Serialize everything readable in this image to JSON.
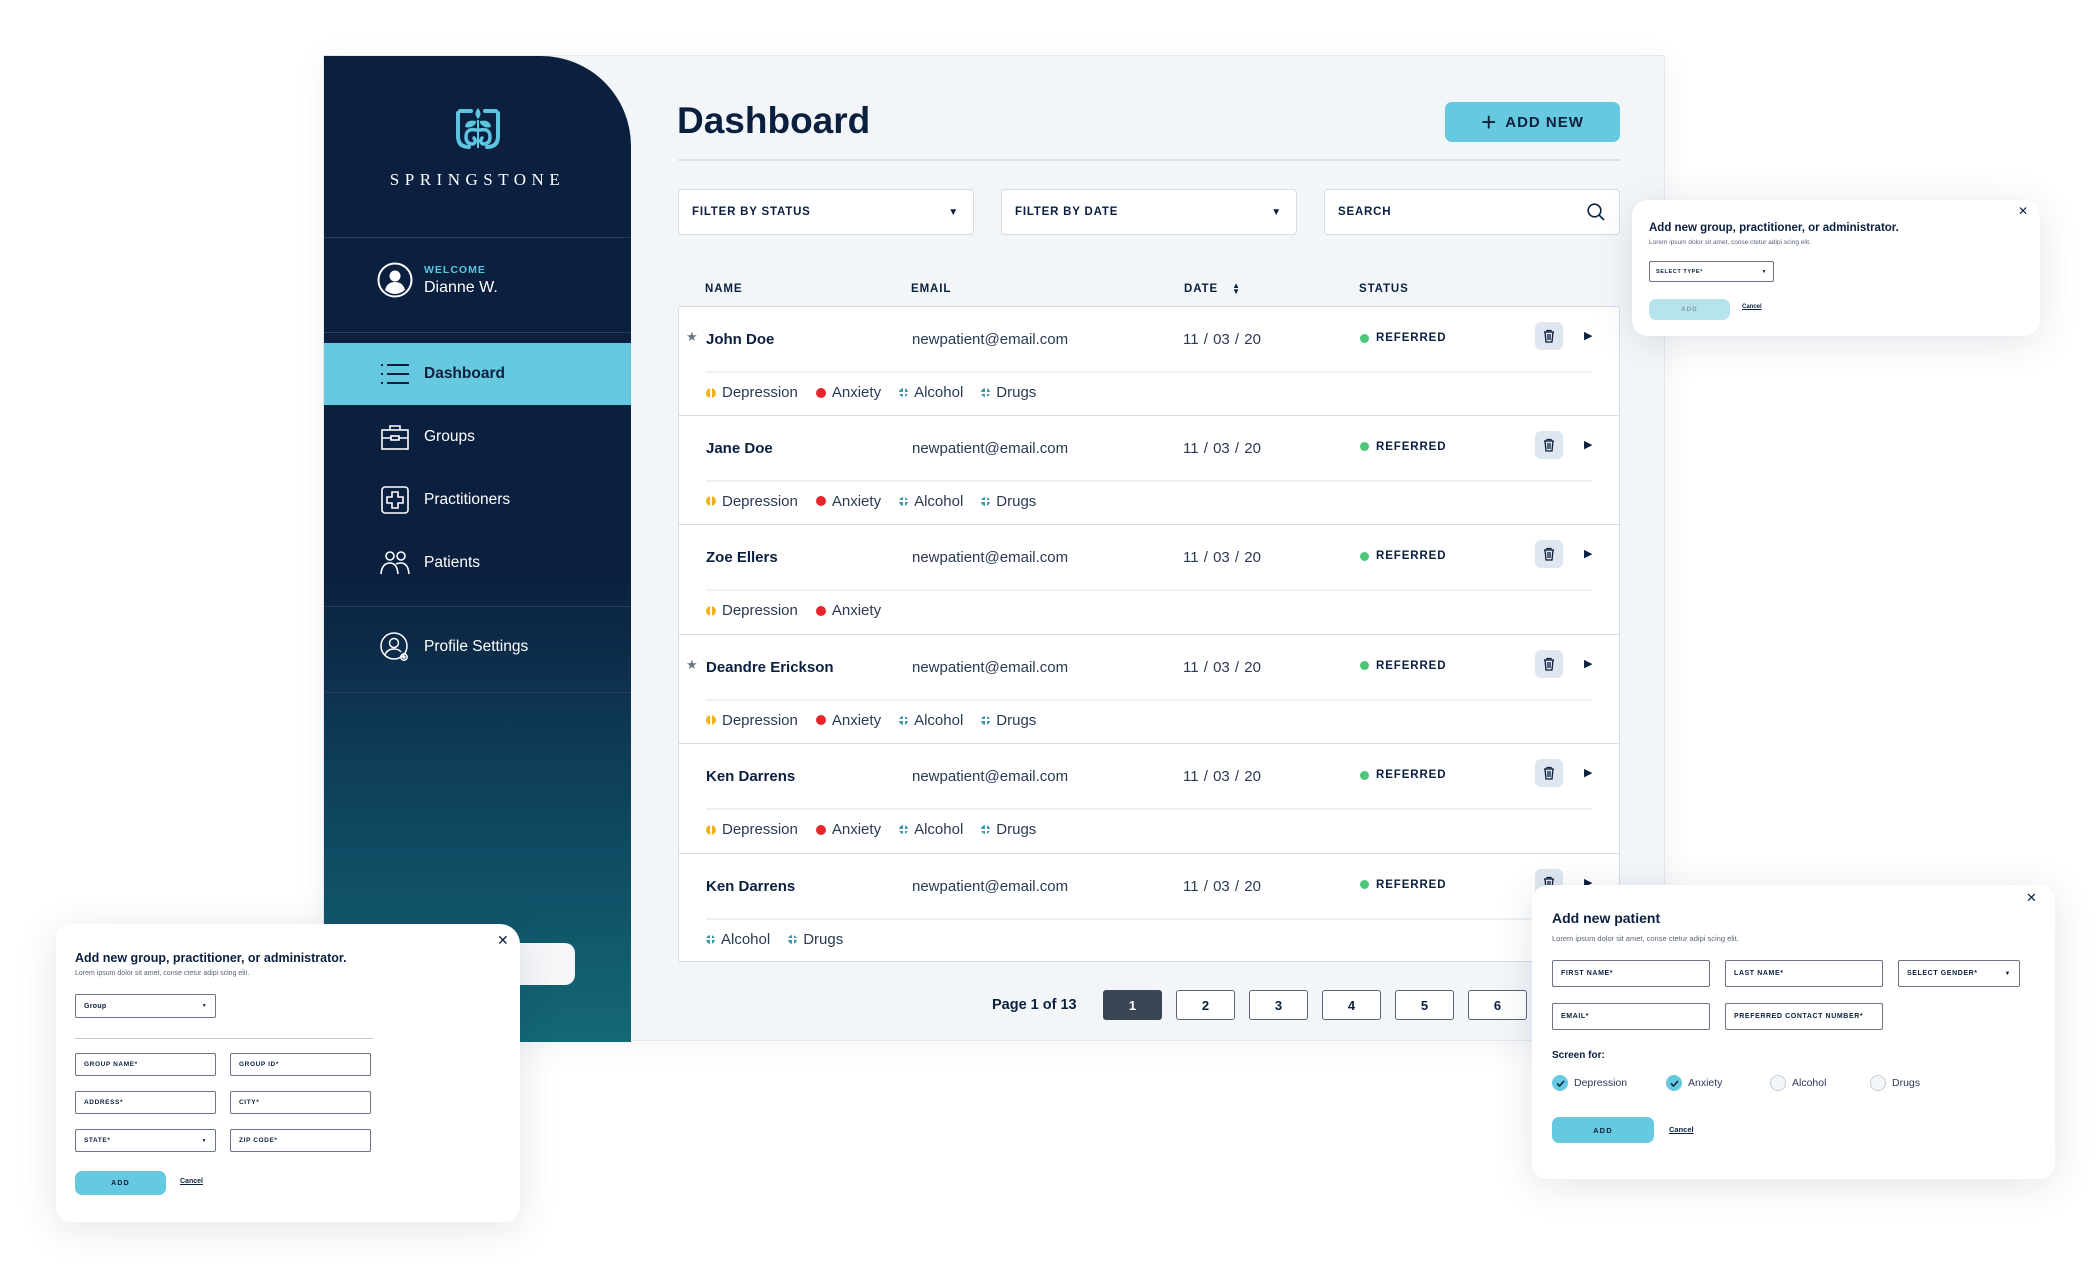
{
  "brand": {
    "name": "SPRINGSTONE",
    "accent": "#67c9df",
    "navy": "#0b1f3f"
  },
  "user": {
    "welcome_label": "WELCOME",
    "name": "Dianne W."
  },
  "sidebar": {
    "items": [
      {
        "label": "Dashboard",
        "icon": "list-icon",
        "active": true
      },
      {
        "label": "Groups",
        "icon": "briefcase-icon"
      },
      {
        "label": "Practitioners",
        "icon": "medical-cross-icon"
      },
      {
        "label": "Patients",
        "icon": "users-icon"
      },
      {
        "label": "Profile Settings",
        "icon": "user-settings-icon"
      }
    ]
  },
  "header": {
    "title": "Dashboard",
    "add_new_label": "ADD NEW"
  },
  "filters": {
    "status": "FILTER BY STATUS",
    "date": "FILTER BY DATE",
    "search_placeholder": "SEARCH"
  },
  "table": {
    "columns": {
      "name": "NAME",
      "email": "EMAIL",
      "date": "DATE",
      "status": "STATUS"
    },
    "rows": [
      {
        "starred": true,
        "name": "John Doe",
        "email": "newpatient@email.com",
        "date": "11 / 03 / 20",
        "status": "REFERRED",
        "tags": [
          "Depression",
          "Anxiety",
          "Alcohol",
          "Drugs"
        ]
      },
      {
        "starred": false,
        "name": "Jane Doe",
        "email": "newpatient@email.com",
        "date": "11 / 03 / 20",
        "status": "REFERRED",
        "tags": [
          "Depression",
          "Anxiety",
          "Alcohol",
          "Drugs"
        ]
      },
      {
        "starred": false,
        "name": "Zoe Ellers",
        "email": "newpatient@email.com",
        "date": "11 / 03 / 20",
        "status": "REFERRED",
        "tags": [
          "Depression",
          "Anxiety"
        ]
      },
      {
        "starred": true,
        "name": "Deandre Erickson",
        "email": "newpatient@email.com",
        "date": "11 / 03 / 20",
        "status": "REFERRED",
        "tags": [
          "Depression",
          "Anxiety",
          "Alcohol",
          "Drugs"
        ]
      },
      {
        "starred": false,
        "name": "Ken Darrens",
        "email": "newpatient@email.com",
        "date": "11 / 03 / 20",
        "status": "REFERRED",
        "tags": [
          "Depression",
          "Anxiety",
          "Alcohol",
          "Drugs"
        ]
      },
      {
        "starred": false,
        "name": "Ken Darrens",
        "email": "newpatient@email.com",
        "date": "11 / 03 / 20",
        "status": "REFERRED",
        "tags": [
          "Alcohol",
          "Drugs"
        ]
      }
    ],
    "tag_colors": {
      "Depression": "#f1b21a",
      "Anxiety": "#e8252b",
      "Alcohol": "#3e97aa",
      "Drugs": "#3e97aa"
    },
    "status_color": "#4cc776"
  },
  "pagination": {
    "label": "Page 1 of 13",
    "current": 1,
    "pages": [
      "1",
      "2",
      "3",
      "4",
      "5",
      "6"
    ]
  },
  "modal_type_select": {
    "title": "Add new group, practitioner, or administrator.",
    "subtitle": "Lorem ipsum dolor sit amet, conse ctetur adipi scing elit.",
    "select_placeholder": "SELECT TYPE*",
    "add_label": "ADD",
    "cancel_label": "Cancel",
    "add_disabled": true
  },
  "modal_group": {
    "title": "Add new group, practitioner, or administrator.",
    "subtitle": "Lorem ipsum dolor sit amet, conse ctetur adipi scing elit.",
    "type_value": "Group",
    "fields": {
      "group_name": "GROUP NAME*",
      "group_id": "GROUP ID*",
      "address": "ADDRESS*",
      "city": "CITY*",
      "state": "STATE*",
      "zip": "ZIP CODE*"
    },
    "add_label": "ADD",
    "cancel_label": "Cancel"
  },
  "modal_patient": {
    "title": "Add new patient",
    "subtitle": "Lorem ipsum dolor sit amet, conse ctetur adipi scing elit.",
    "fields": {
      "first_name": "FIRST NAME*",
      "last_name": "LAST NAME*",
      "gender": "SELECT GENDER*",
      "email": "EMAIL*",
      "phone": "PREFERRED CONTACT NUMBER*"
    },
    "screen_for_label": "Screen for:",
    "screen_options": [
      {
        "label": "Depression",
        "checked": true
      },
      {
        "label": "Anxiety",
        "checked": true
      },
      {
        "label": "Alcohol",
        "checked": false
      },
      {
        "label": "Drugs",
        "checked": false
      }
    ],
    "add_label": "ADD",
    "cancel_label": "Cancel"
  }
}
